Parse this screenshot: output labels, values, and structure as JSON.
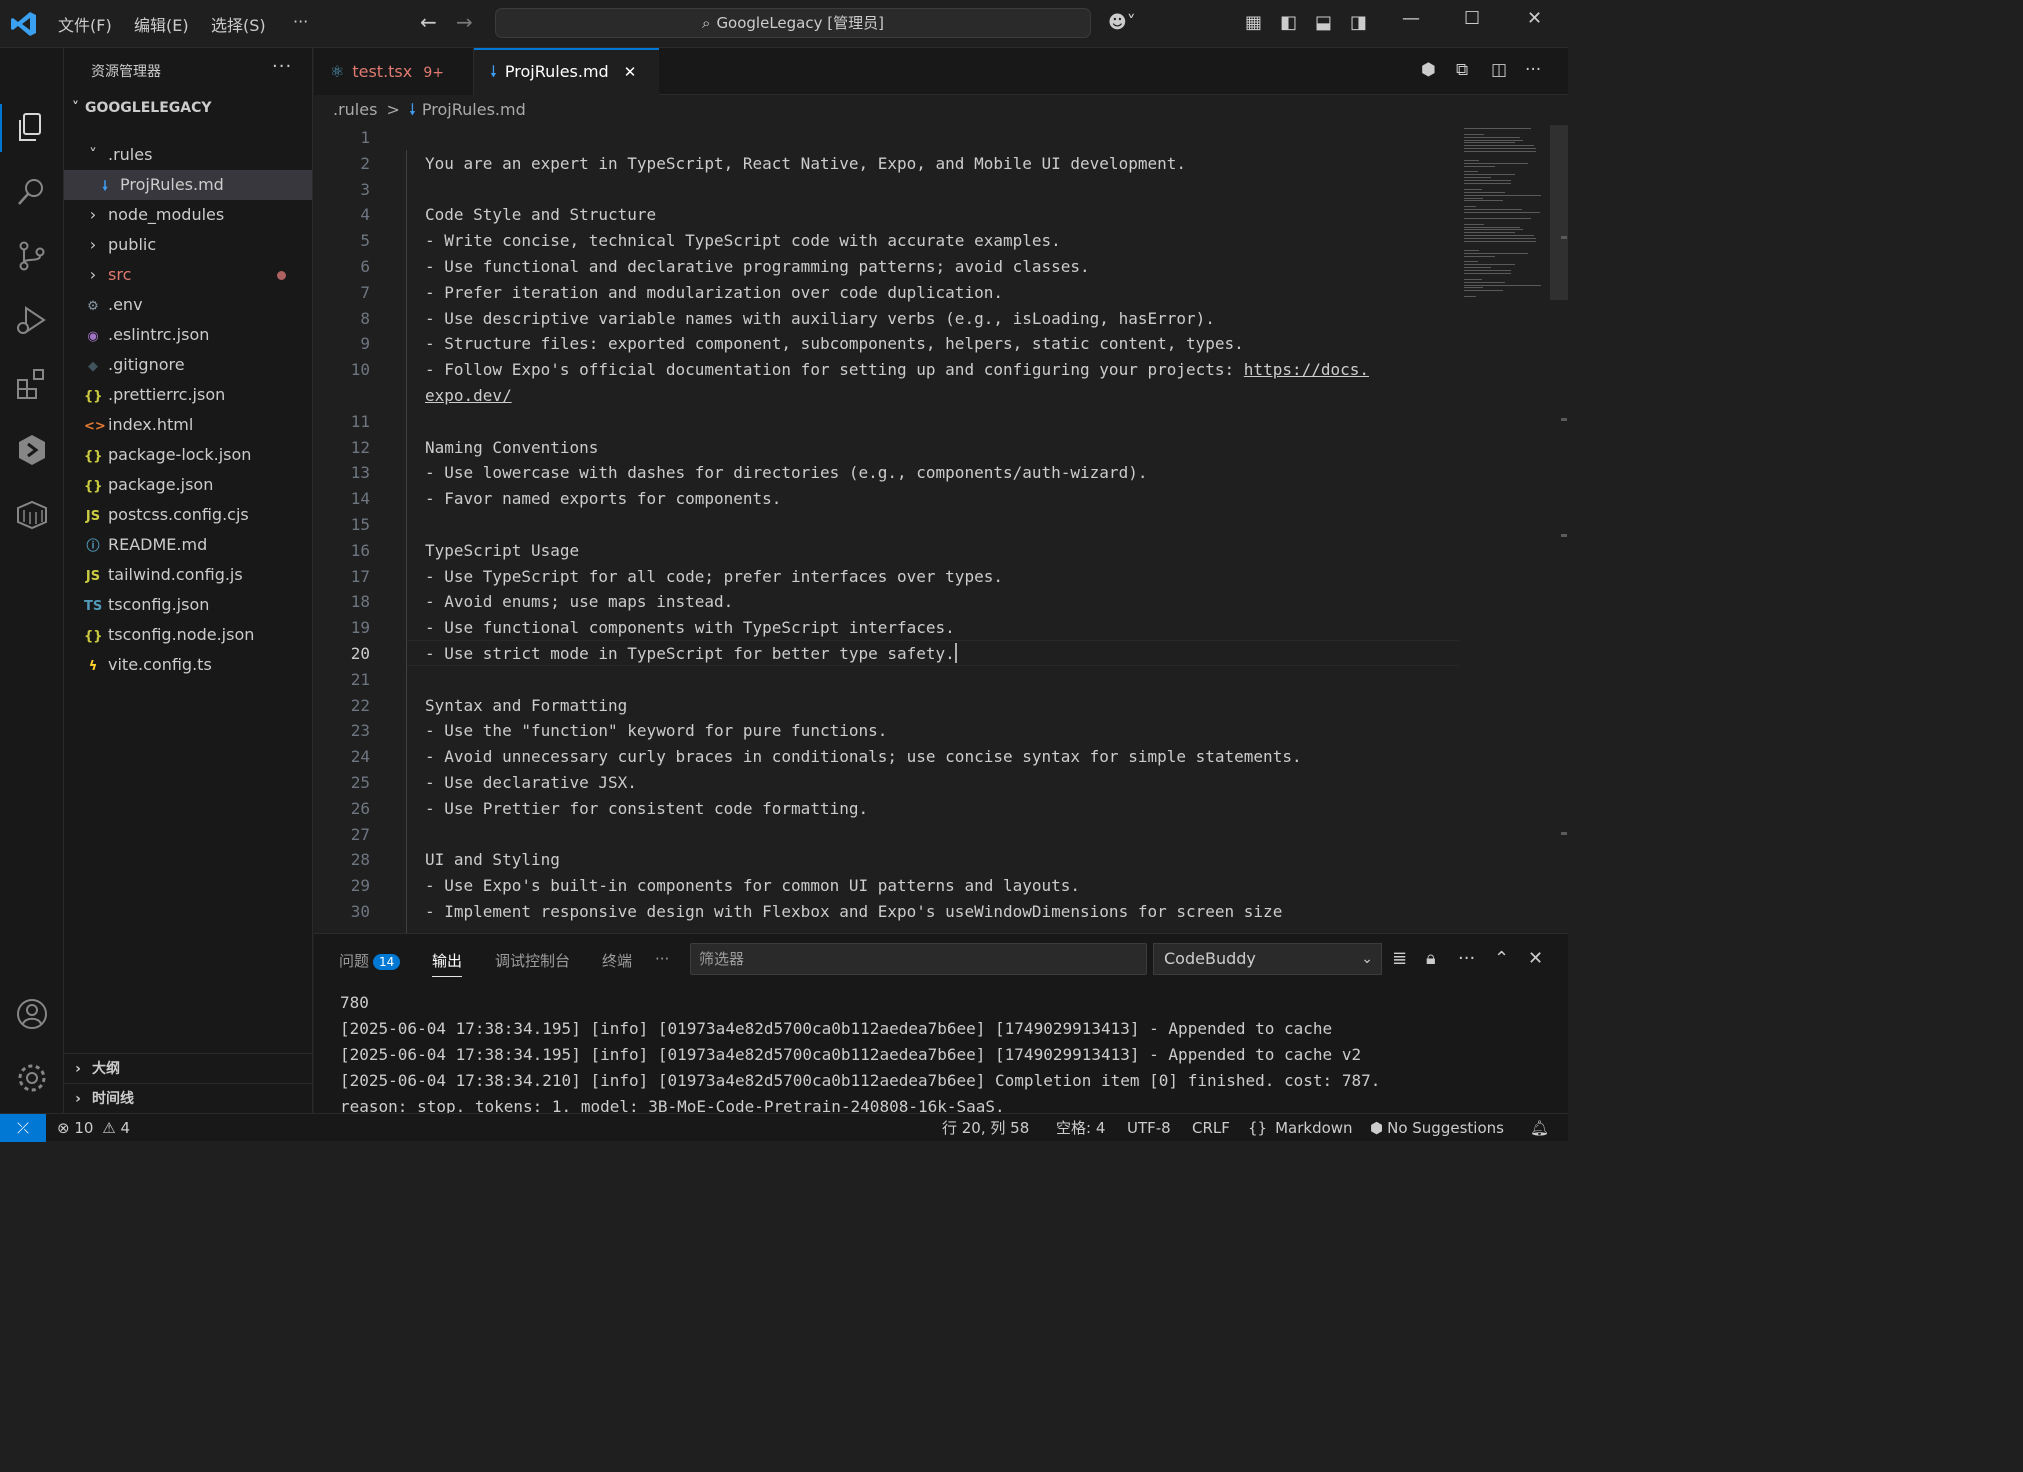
{
  "menu": {
    "file": "文件(F)",
    "edit": "编辑(E)",
    "select": "选择(S)",
    "more": "···"
  },
  "search": {
    "text": "GoogleLegacy [管理员]"
  },
  "sidebar": {
    "title": "资源管理器",
    "more": "···",
    "root": "GOOGLELEGACY",
    "items": [
      {
        "label": ".rules",
        "type": "folder-open",
        "icon": "chevron-down",
        "color": "#cccccc"
      },
      {
        "label": "ProjRules.md",
        "type": "file",
        "icon": "markdown-icon",
        "glyph": "🠗",
        "color": "#cccccc",
        "icon_color": "#3d9bf0"
      },
      {
        "label": "node_modules",
        "type": "folder",
        "icon": "chevron-right",
        "color": "#cccccc"
      },
      {
        "label": "public",
        "type": "folder",
        "icon": "chevron-right",
        "color": "#cccccc"
      },
      {
        "label": "src",
        "type": "folder",
        "icon": "chevron-right",
        "color": "#e07a70"
      },
      {
        "label": ".env",
        "type": "file",
        "icon": "gear-icon",
        "glyph": "⚙",
        "color": "#cccccc",
        "icon_color": "#8c9aa5"
      },
      {
        "label": ".eslintrc.json",
        "type": "file",
        "icon": "eslint-icon",
        "glyph": "◉",
        "color": "#cccccc",
        "icon_color": "#a074c4"
      },
      {
        "label": ".gitignore",
        "type": "file",
        "icon": "git-icon",
        "glyph": "◆",
        "color": "#cccccc",
        "icon_color": "#41535b"
      },
      {
        "label": ".prettierrc.json",
        "type": "file",
        "icon": "json-icon",
        "glyph": "{}",
        "color": "#cccccc",
        "icon_color": "#cbcb41"
      },
      {
        "label": "index.html",
        "type": "file",
        "icon": "html-icon",
        "glyph": "<>",
        "color": "#cccccc",
        "icon_color": "#e37933"
      },
      {
        "label": "package-lock.json",
        "type": "file",
        "icon": "json-icon",
        "glyph": "{}",
        "color": "#cccccc",
        "icon_color": "#cbcb41"
      },
      {
        "label": "package.json",
        "type": "file",
        "icon": "json-icon",
        "glyph": "{}",
        "color": "#cccccc",
        "icon_color": "#cbcb41"
      },
      {
        "label": "postcss.config.cjs",
        "type": "file",
        "icon": "js-icon",
        "glyph": "JS",
        "color": "#cccccc",
        "icon_color": "#cbcb41"
      },
      {
        "label": "README.md",
        "type": "file",
        "icon": "info-icon",
        "glyph": "ⓘ",
        "color": "#cccccc",
        "icon_color": "#519aba"
      },
      {
        "label": "tailwind.config.js",
        "type": "file",
        "icon": "js-icon",
        "glyph": "JS",
        "color": "#cccccc",
        "icon_color": "#cbcb41"
      },
      {
        "label": "tsconfig.json",
        "type": "file",
        "icon": "ts-icon",
        "glyph": "TS",
        "color": "#cccccc",
        "icon_color": "#519aba"
      },
      {
        "label": "tsconfig.node.json",
        "type": "file",
        "icon": "json-icon",
        "glyph": "{}",
        "color": "#cccccc",
        "icon_color": "#cbcb41"
      },
      {
        "label": "vite.config.ts",
        "type": "file",
        "icon": "vite-icon",
        "glyph": "ϟ",
        "color": "#cccccc",
        "icon_color": "#ffd62e"
      }
    ],
    "outline": "大纲",
    "timeline": "时间线"
  },
  "tabs": [
    {
      "label": "test.tsx",
      "badge": "9+"
    },
    {
      "label": "ProjRules.md",
      "close": "✕"
    }
  ],
  "breadcrumb": {
    "folder": ".rules",
    "sep": ">",
    "file": "ProjRules.md"
  },
  "editor": {
    "line_numbers": [
      "1",
      "2",
      "3",
      "4",
      "5",
      "6",
      "7",
      "8",
      "9",
      "10",
      "",
      "11",
      "12",
      "13",
      "14",
      "15",
      "16",
      "17",
      "18",
      "19",
      "20",
      "21",
      "22",
      "23",
      "24",
      "25",
      "26",
      "27",
      "28",
      "29",
      "30"
    ],
    "current_line": "20",
    "lines": [
      "",
      "You are an expert in TypeScript, React Native, Expo, and Mobile UI development.",
      "",
      "Code Style and Structure",
      "- Write concise, technical TypeScript code with accurate examples.",
      "- Use functional and declarative programming patterns; avoid classes.",
      "- Prefer iteration and modularization over code duplication.",
      "- Use descriptive variable names with auxiliary verbs (e.g., isLoading, hasError).",
      "- Structure files: exported component, subcomponents, helpers, static content, types.",
      "- Follow Expo's official documentation for setting up and configuring your projects: ",
      "",
      "",
      "Naming Conventions",
      "- Use lowercase with dashes for directories (e.g., components/auth-wizard).",
      "- Favor named exports for components.",
      "",
      "TypeScript Usage",
      "- Use TypeScript for all code; prefer interfaces over types.",
      "- Avoid enums; use maps instead.",
      "- Use functional components with TypeScript interfaces.",
      "- Use strict mode in TypeScript for better type safety.",
      "",
      "Syntax and Formatting",
      "- Use the \"function\" keyword for pure functions.",
      "- Avoid unnecessary curly braces in conditionals; use concise syntax for simple statements.",
      "- Use declarative JSX.",
      "- Use Prettier for consistent code formatting.",
      "",
      "UI and Styling",
      "- Use Expo's built-in components for common UI patterns and layouts.",
      "- Implement responsive design with Flexbox and Expo's useWindowDimensions for screen size"
    ],
    "link_part1": "https://docs.",
    "link_part2": "expo.dev/"
  },
  "panel": {
    "tabs": {
      "problems": "问题",
      "problems_count": "14",
      "output": "输出",
      "debug": "调试控制台",
      "terminal": "终端",
      "more": "···"
    },
    "filter_placeholder": "筛选器",
    "source": "CodeBuddy",
    "output_lines": [
      "780",
      "[2025-06-04 17:38:34.195] [info] [01973a4e82d5700ca0b112aedea7b6ee] [1749029913413] - Appended to cache",
      "[2025-06-04 17:38:34.195] [info] [01973a4e82d5700ca0b112aedea7b6ee] [1749029913413] - Appended to cache v2",
      "[2025-06-04 17:38:34.210] [info] [01973a4e82d5700ca0b112aedea7b6ee] Completion item [0] finished. cost: 787.",
      "reason: stop. tokens: 1. model: 3B-MoE-Code-Pretrain-240808-16k-SaaS."
    ]
  },
  "status": {
    "errors": "10",
    "warnings": "4",
    "position": "行 20, 列 58",
    "spaces": "空格: 4",
    "encoding": "UTF-8",
    "eol": "CRLF",
    "language_glyph": "{}",
    "language": "Markdown",
    "suggestions": "No Suggestions"
  },
  "colors": {
    "accent": "#0078d4",
    "bg": "#1f1f1f",
    "sidebar_bg": "#181818",
    "error_text": "#e07a70"
  }
}
